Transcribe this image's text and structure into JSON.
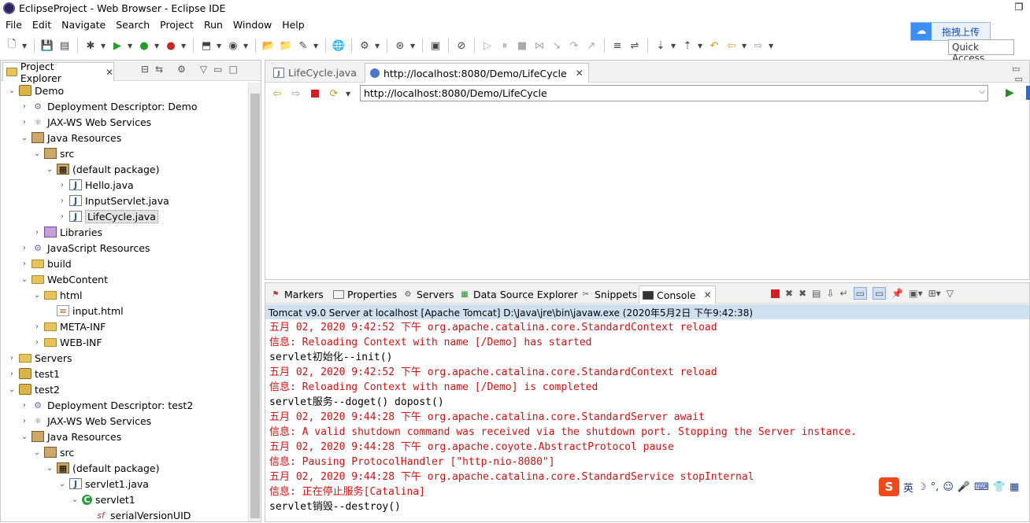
{
  "window": {
    "title": "EclipseProject - Web Browser - Eclipse IDE"
  },
  "menu": [
    "File",
    "Edit",
    "Navigate",
    "Search",
    "Project",
    "Run",
    "Window",
    "Help"
  ],
  "baidu": {
    "label": "拖拽上传"
  },
  "quick_access": {
    "placeholder": "Quick Access"
  },
  "project_explorer": {
    "tab_label": "Project Explorer",
    "tree": [
      {
        "label": "Demo",
        "depth": 0,
        "twisty": "open",
        "icon": "project-icon"
      },
      {
        "label": "Deployment Descriptor: Demo",
        "depth": 1,
        "twisty": "closed",
        "icon": "deployment-descriptor-icon"
      },
      {
        "label": "JAX-WS Web Services",
        "depth": 1,
        "twisty": "closed",
        "icon": "webservice-icon"
      },
      {
        "label": "Java Resources",
        "depth": 1,
        "twisty": "open",
        "icon": "java-resources-icon"
      },
      {
        "label": "src",
        "depth": 2,
        "twisty": "open",
        "icon": "source-folder-icon"
      },
      {
        "label": "(default package)",
        "depth": 3,
        "twisty": "open",
        "icon": "package-icon"
      },
      {
        "label": "Hello.java",
        "depth": 4,
        "twisty": "closed",
        "icon": "java-file-icon"
      },
      {
        "label": "InputServlet.java",
        "depth": 4,
        "twisty": "closed",
        "icon": "java-file-icon"
      },
      {
        "label": "LifeCycle.java",
        "depth": 4,
        "twisty": "closed",
        "icon": "java-file-icon",
        "selected": true
      },
      {
        "label": "Libraries",
        "depth": 2,
        "twisty": "closed",
        "icon": "library-icon"
      },
      {
        "label": "JavaScript Resources",
        "depth": 1,
        "twisty": "closed",
        "icon": "javascript-resources-icon"
      },
      {
        "label": "build",
        "depth": 1,
        "twisty": "closed",
        "icon": "folder-icon"
      },
      {
        "label": "WebContent",
        "depth": 1,
        "twisty": "open",
        "icon": "folder-icon"
      },
      {
        "label": "html",
        "depth": 2,
        "twisty": "open",
        "icon": "folder-icon"
      },
      {
        "label": "input.html",
        "depth": 3,
        "twisty": "none",
        "icon": "html-file-icon"
      },
      {
        "label": "META-INF",
        "depth": 2,
        "twisty": "closed",
        "icon": "folder-icon"
      },
      {
        "label": "WEB-INF",
        "depth": 2,
        "twisty": "closed",
        "icon": "folder-icon"
      },
      {
        "label": "Servers",
        "depth": 0,
        "twisty": "closed",
        "icon": "folder-icon"
      },
      {
        "label": "test1",
        "depth": 0,
        "twisty": "closed",
        "icon": "project-icon"
      },
      {
        "label": "test2",
        "depth": 0,
        "twisty": "open",
        "icon": "project-icon"
      },
      {
        "label": "Deployment Descriptor: test2",
        "depth": 1,
        "twisty": "closed",
        "icon": "deployment-descriptor-icon"
      },
      {
        "label": "JAX-WS Web Services",
        "depth": 1,
        "twisty": "closed",
        "icon": "webservice-icon"
      },
      {
        "label": "Java Resources",
        "depth": 1,
        "twisty": "open",
        "icon": "java-resources-icon"
      },
      {
        "label": "src",
        "depth": 2,
        "twisty": "open",
        "icon": "source-folder-icon"
      },
      {
        "label": "(default package)",
        "depth": 3,
        "twisty": "open",
        "icon": "package-icon"
      },
      {
        "label": "servlet1.java",
        "depth": 4,
        "twisty": "open",
        "icon": "java-file-icon"
      },
      {
        "label": "servlet1",
        "depth": 5,
        "twisty": "open",
        "icon": "class-icon"
      },
      {
        "label": "serialVersionUID",
        "depth": 6,
        "twisty": "none",
        "icon": "field-icon"
      }
    ]
  },
  "editor": {
    "tabs": [
      {
        "label": "LifeCycle.java",
        "active": false
      },
      {
        "label": "http://localhost:8080/Demo/LifeCycle",
        "active": true
      }
    ],
    "url": "http://localhost:8080/Demo/LifeCycle"
  },
  "console": {
    "tabs": [
      "Markers",
      "Properties",
      "Servers",
      "Data Source Explorer",
      "Snippets",
      "Console"
    ],
    "active_tab": "Console",
    "process_label": "Tomcat v9.0 Server at localhost [Apache Tomcat] D:\\Java\\jre\\bin\\javaw.exe (2020年5月2日 下午9:42:38)",
    "lines": [
      {
        "text": "五月 02, 2020 9:42:52 下午 org.apache.catalina.core.StandardContext reload",
        "color": "red"
      },
      {
        "text": "信息: Reloading Context with name [/Demo] has started",
        "color": "red"
      },
      {
        "text": "servlet初始化--init()",
        "color": "black"
      },
      {
        "text": "五月 02, 2020 9:42:52 下午 org.apache.catalina.core.StandardContext reload",
        "color": "red"
      },
      {
        "text": "信息: Reloading Context with name [/Demo] is completed",
        "color": "red"
      },
      {
        "text": "servlet服务--doget() dopost()",
        "color": "black"
      },
      {
        "text": "五月 02, 2020 9:44:28 下午 org.apache.catalina.core.StandardServer await",
        "color": "red"
      },
      {
        "text": "信息: A valid shutdown command was received via the shutdown port. Stopping the Server instance.",
        "color": "red"
      },
      {
        "text": "五月 02, 2020 9:44:28 下午 org.apache.coyote.AbstractProtocol pause",
        "color": "red"
      },
      {
        "text": "信息: Pausing ProtocolHandler [\"http-nio-8080\"]",
        "color": "red"
      },
      {
        "text": "五月 02, 2020 9:44:28 下午 org.apache.catalina.core.StandardService stopInternal",
        "color": "red"
      },
      {
        "text": "信息: 正在停止服务[Catalina]",
        "color": "red"
      },
      {
        "text": "servlet销毁--destroy()",
        "color": "black"
      }
    ]
  },
  "ime": {
    "label": "英"
  }
}
